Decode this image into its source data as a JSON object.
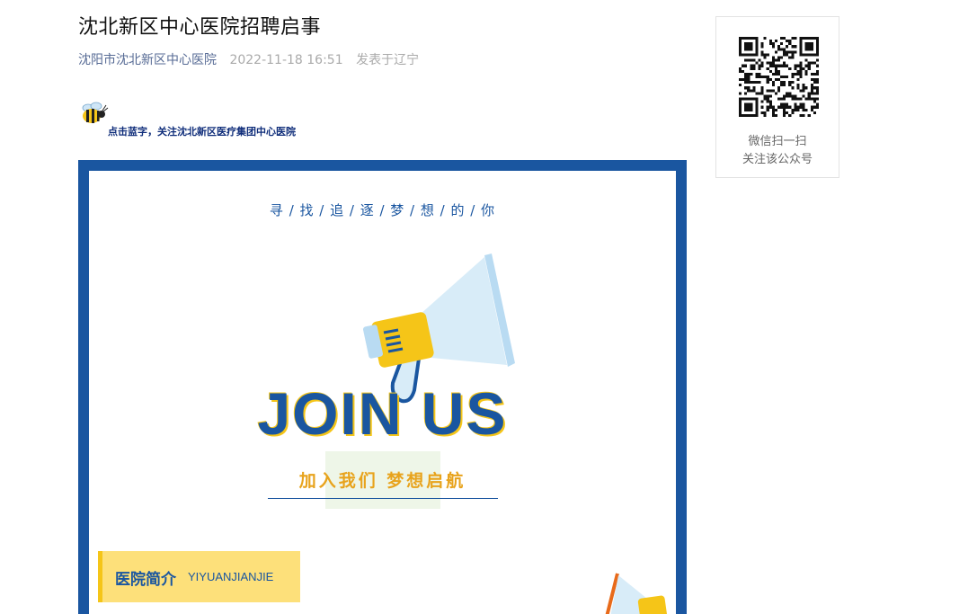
{
  "article": {
    "title": "沈北新区中心医院招聘启事",
    "author": "沈阳市沈北新区中心医院",
    "date": "2022-11-18 16:51",
    "location": "发表于辽宁"
  },
  "follow": {
    "text": "点击蓝字，关注沈北新区医疗集团中心医院"
  },
  "poster": {
    "tagline": "寻 / 找 / 追 / 逐 / 梦 / 想 / 的 / 你",
    "headline": "JOIN US",
    "slogan": "加入我们  梦想启航",
    "section_zh": "医院简介",
    "section_en": "YIYUANJIANJIE",
    "colors": {
      "frame": "#1a56a0",
      "accent": "#f5c518",
      "orange": "#e8a31c"
    }
  },
  "qr_card": {
    "line1": "微信扫一扫",
    "line2": "关注该公众号"
  }
}
